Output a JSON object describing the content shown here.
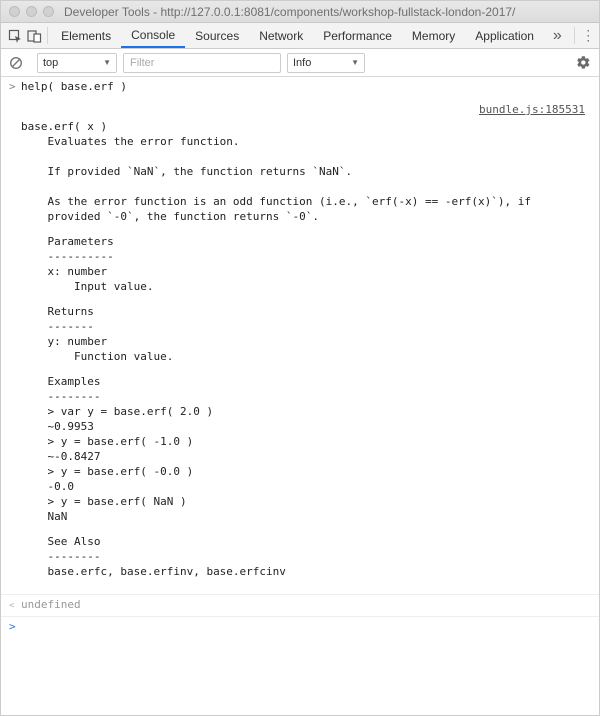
{
  "titlebar": {
    "title": "Developer Tools - http://127.0.0.1:8081/components/workshop-fullstack-london-2017/"
  },
  "tabs": {
    "elements": "Elements",
    "console": "Console",
    "sources": "Sources",
    "network": "Network",
    "performance": "Performance",
    "memory": "Memory",
    "application": "Application",
    "more": "»",
    "kebab": "⋮"
  },
  "filterbar": {
    "context": "top",
    "filter_ph": "Filter",
    "level": "Info"
  },
  "console": {
    "input_cmd": "help( base.erf )",
    "source_link": "bundle.js:185531",
    "sig": "base.erf( x )",
    "desc1": "    Evaluates the error function.",
    "desc2": "    If provided `NaN`, the function returns `NaN`.",
    "desc3": "    As the error function is an odd function (i.e., `erf(-x) == -erf(x)`), if",
    "desc4": "    provided `-0`, the function returns `-0`.",
    "params_h": "    Parameters",
    "params_d": "    ----------",
    "param1": "    x: number",
    "param1d": "        Input value.",
    "returns_h": "    Returns",
    "returns_d": "    -------",
    "ret1": "    y: number",
    "ret1d": "        Function value.",
    "ex_h": "    Examples",
    "ex_d": "    --------",
    "ex1": "    > var y = base.erf( 2.0 )",
    "ex1r": "    ~0.9953",
    "ex2": "    > y = base.erf( -1.0 )",
    "ex2r": "    ~-0.8427",
    "ex3": "    > y = base.erf( -0.0 )",
    "ex3r": "    -0.0",
    "ex4": "    > y = base.erf( NaN )",
    "ex4r": "    NaN",
    "sa_h": "    See Also",
    "sa_d": "    --------",
    "sa1": "    base.erfc, base.erfinv, base.erfcinv",
    "result": "undefined"
  }
}
